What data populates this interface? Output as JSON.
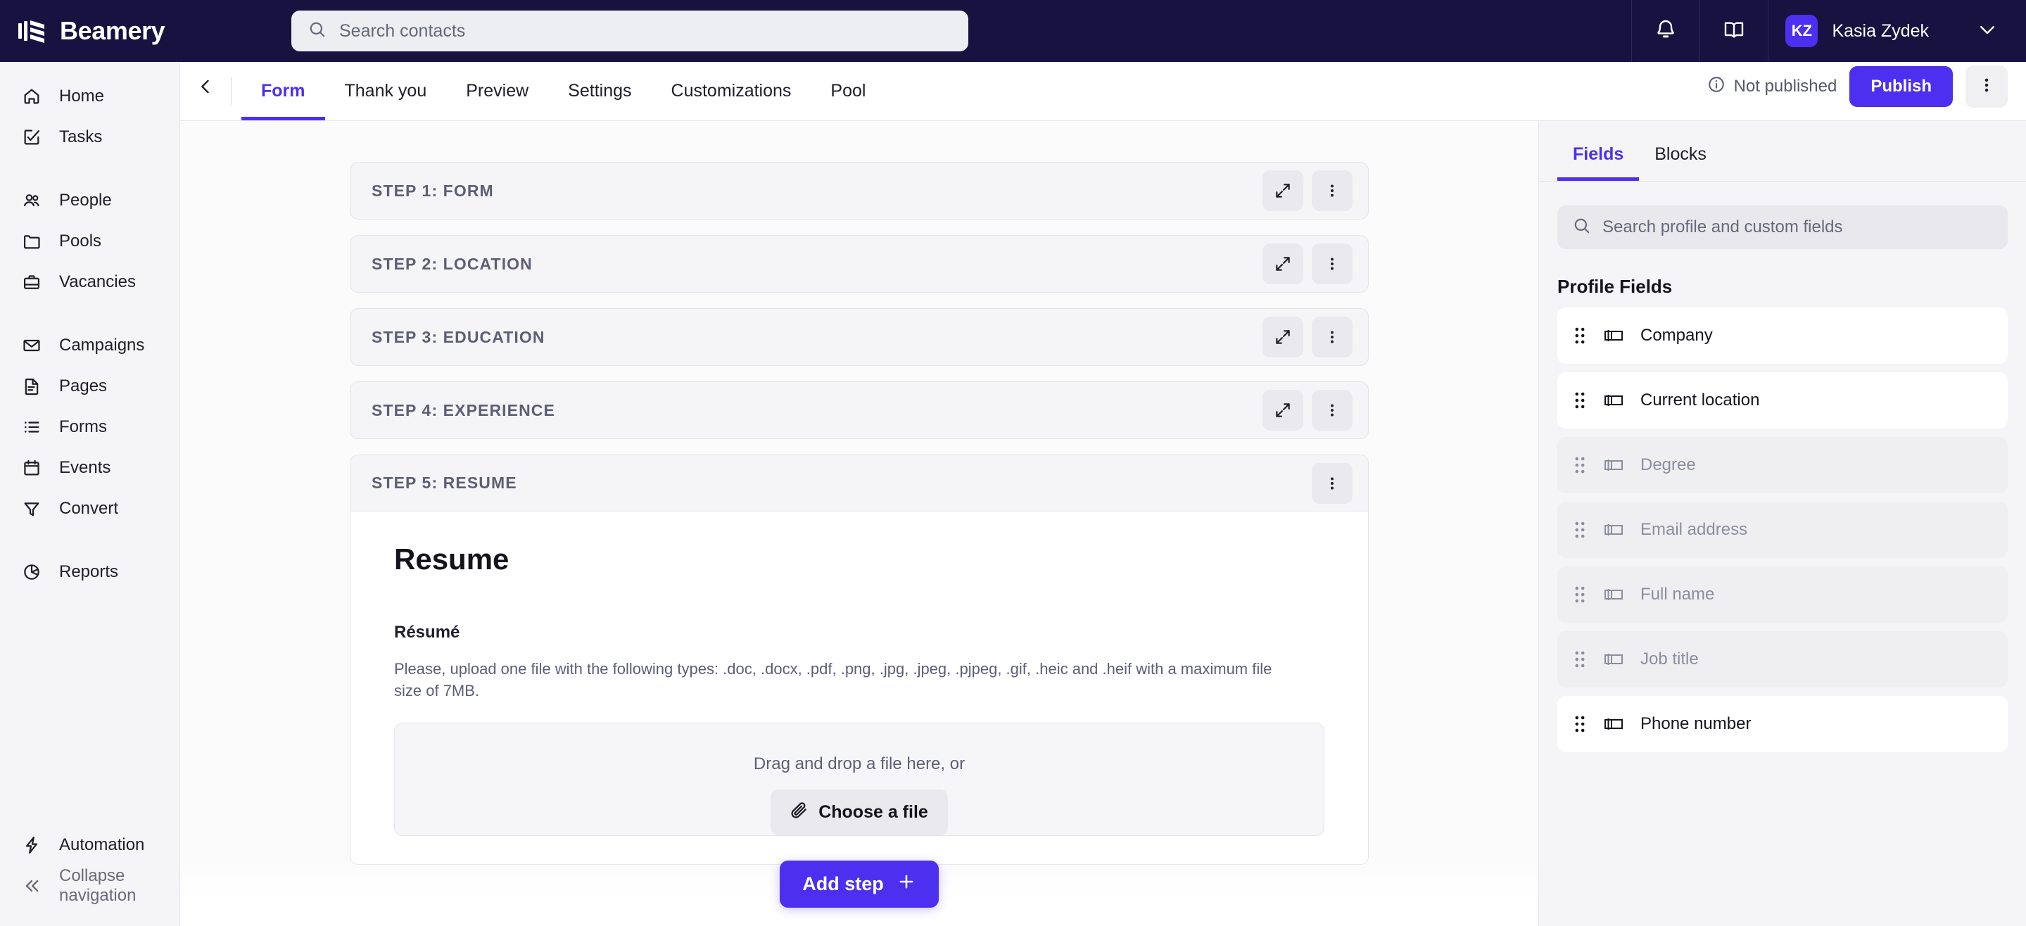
{
  "brand": {
    "name": "Beamery",
    "accent": "#4d2ff0",
    "topbar_bg": "#181240"
  },
  "topbar": {
    "search_placeholder": "Search contacts",
    "search_value": "",
    "notifications_icon": "bell-icon",
    "knowledge_icon": "book-icon",
    "user": {
      "initials": "KZ",
      "name": "Kasia Zydek"
    }
  },
  "sidebar": {
    "items": [
      {
        "label": "Home",
        "icon": "home-icon"
      },
      {
        "label": "Tasks",
        "icon": "task-check-icon"
      },
      {
        "label": "People",
        "icon": "people-icon"
      },
      {
        "label": "Pools",
        "icon": "folder-icon"
      },
      {
        "label": "Vacancies",
        "icon": "briefcase-icon"
      },
      {
        "label": "Campaigns",
        "icon": "envelope-icon"
      },
      {
        "label": "Pages",
        "icon": "document-icon"
      },
      {
        "label": "Forms",
        "icon": "list-icon"
      },
      {
        "label": "Events",
        "icon": "calendar-icon"
      },
      {
        "label": "Convert",
        "icon": "funnel-icon"
      },
      {
        "label": "Reports",
        "icon": "pie-chart-icon"
      },
      {
        "label": "Automation",
        "icon": "lightning-icon"
      }
    ],
    "collapse": {
      "label": "Collapse navigation",
      "icon": "chevrons-left-icon"
    }
  },
  "subheader": {
    "back_icon": "chevron-left-icon",
    "tabs": [
      {
        "label": "Form",
        "active": true
      },
      {
        "label": "Thank you",
        "active": false
      },
      {
        "label": "Preview",
        "active": false
      },
      {
        "label": "Settings",
        "active": false
      },
      {
        "label": "Customizations",
        "active": false
      },
      {
        "label": "Pool",
        "active": false
      }
    ],
    "status_text": "Not published",
    "status_icon": "info-icon",
    "publish_label": "Publish",
    "more_icon": "kebab-menu-icon"
  },
  "canvas": {
    "steps": [
      {
        "title": "STEP 1: FORM",
        "open": false
      },
      {
        "title": "STEP 2: LOCATION",
        "open": false
      },
      {
        "title": "STEP 3: EDUCATION",
        "open": false
      },
      {
        "title": "STEP 4: EXPERIENCE",
        "open": false
      },
      {
        "title": "STEP 5: RESUME",
        "open": true
      }
    ],
    "resume_step": {
      "heading": "Resume",
      "field_label": "Résumé",
      "description": "Please, upload one file with the following types: .doc, .docx, .pdf, .png, .jpg, .jpeg, .pjpeg, .gif, .heic and .heif with a maximum file size of 7MB.",
      "dropzone_text": "Drag and drop a file here, or",
      "choose_file_label": "Choose a file"
    },
    "add_step_label": "Add step"
  },
  "right_panel": {
    "tabs": [
      {
        "label": "Fields",
        "active": true
      },
      {
        "label": "Blocks",
        "active": false
      }
    ],
    "search_placeholder": "Search profile and custom fields",
    "search_value": "",
    "section_title": "Profile Fields",
    "fields": [
      {
        "label": "Company",
        "enabled": true
      },
      {
        "label": "Current location",
        "enabled": true
      },
      {
        "label": "Degree",
        "enabled": false
      },
      {
        "label": "Email address",
        "enabled": false
      },
      {
        "label": "Full name",
        "enabled": false
      },
      {
        "label": "Job title",
        "enabled": false
      },
      {
        "label": "Phone number",
        "enabled": true
      }
    ]
  }
}
